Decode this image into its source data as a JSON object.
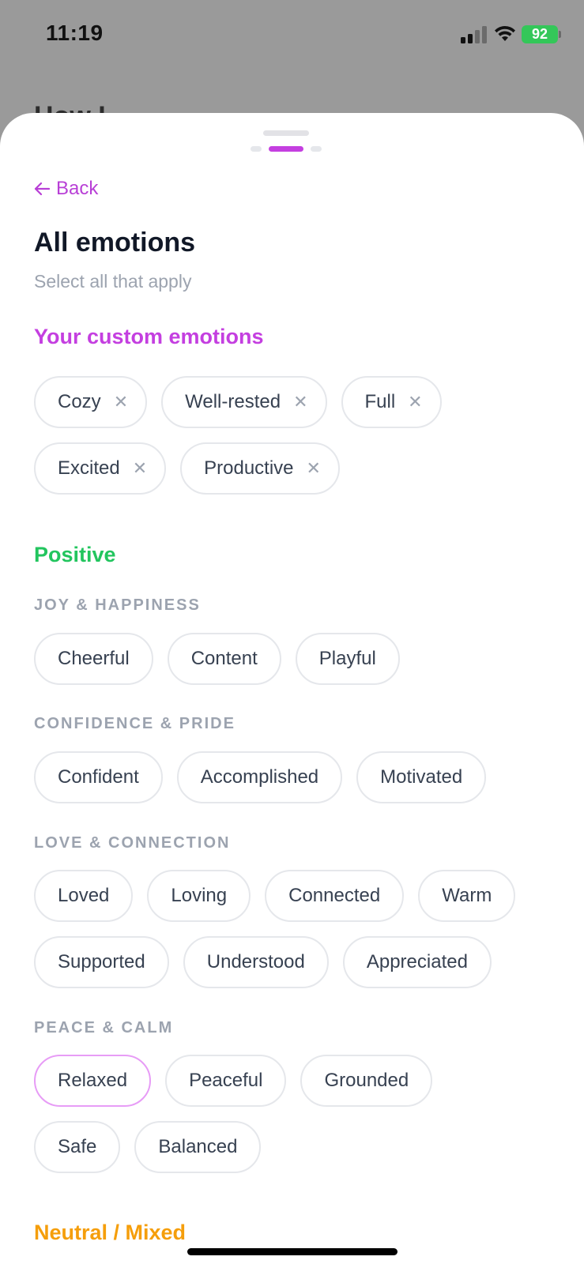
{
  "status": {
    "time": "11:19",
    "battery": "92"
  },
  "background": {
    "title_fragment": "How I…"
  },
  "header": {
    "back_label": "Back",
    "title": "All emotions",
    "subtitle": "Select all that apply"
  },
  "custom": {
    "title": "Your custom emotions",
    "title_color": "#c43fe0",
    "rows": [
      [
        "Cozy",
        "Well-rested",
        "Full"
      ],
      [
        "Excited",
        "Productive"
      ]
    ]
  },
  "positive": {
    "title": "Positive",
    "title_color": "#22c55e",
    "groups": [
      {
        "label": "JOY & HAPPINESS",
        "rows": [
          [
            "Cheerful",
            "Content",
            "Playful"
          ]
        ]
      },
      {
        "label": "CONFIDENCE & PRIDE",
        "rows": [
          [
            "Confident",
            "Accomplished",
            "Motivated"
          ]
        ]
      },
      {
        "label": "LOVE & CONNECTION",
        "rows": [
          [
            "Loved",
            "Loving",
            "Connected",
            "Warm"
          ],
          [
            "Supported",
            "Understood",
            "Appreciated"
          ]
        ]
      },
      {
        "label": "PEACE & CALM",
        "rows": [
          [
            "Relaxed",
            "Peaceful",
            "Grounded"
          ],
          [
            "Safe",
            "Balanced"
          ]
        ]
      }
    ]
  },
  "neutral": {
    "title": "Neutral / Mixed",
    "title_color": "#f59e0b"
  },
  "selected": [
    "Relaxed"
  ],
  "accent_color": "#c43fe0"
}
